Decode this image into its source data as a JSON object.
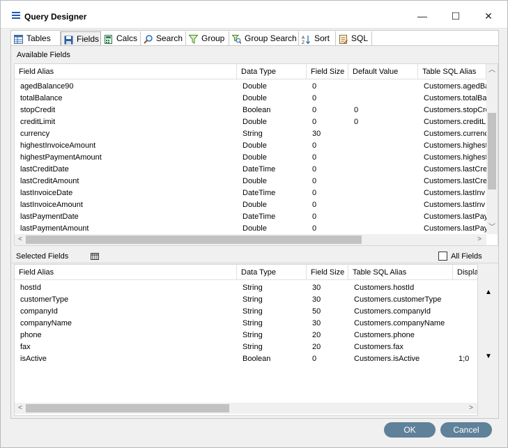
{
  "window": {
    "title": "Query Designer",
    "minimize": "—",
    "maximize": "☐",
    "close": "✕"
  },
  "tabs": [
    {
      "label": "Tables",
      "icon": "table-icon"
    },
    {
      "label": "Fields",
      "icon": "save-disk-icon"
    },
    {
      "label": "Calcs",
      "icon": "calculator-icon"
    },
    {
      "label": "Search",
      "icon": "magnifier-icon"
    },
    {
      "label": "Group",
      "icon": "funnel-icon"
    },
    {
      "label": "Group Search",
      "icon": "funnel-search-icon"
    },
    {
      "label": "Sort",
      "icon": "sort-az-icon"
    },
    {
      "label": "SQL",
      "icon": "sql-script-icon"
    }
  ],
  "available": {
    "label": "Available Fields",
    "columns": [
      "Field Alias",
      "Data Type",
      "Field Size",
      "Default Value",
      "Table SQL Alias"
    ],
    "rows": [
      [
        "agedBalance90",
        "Double",
        "0",
        "",
        "Customers.agedBa"
      ],
      [
        "totalBalance",
        "Double",
        "0",
        "",
        "Customers.totalBa"
      ],
      [
        "stopCredit",
        "Boolean",
        "0",
        "0",
        "Customers.stopCre"
      ],
      [
        "creditLimit",
        "Double",
        "0",
        "0",
        "Customers.creditLi"
      ],
      [
        "currency",
        "String",
        "30",
        "",
        "Customers.currenc"
      ],
      [
        "highestInvoiceAmount",
        "Double",
        "0",
        "",
        "Customers.highest"
      ],
      [
        "highestPaymentAmount",
        "Double",
        "0",
        "",
        "Customers.highest"
      ],
      [
        "lastCreditDate",
        "DateTime",
        "0",
        "",
        "Customers.lastCre"
      ],
      [
        "lastCreditAmount",
        "Double",
        "0",
        "",
        "Customers.lastCre"
      ],
      [
        "lastInvoiceDate",
        "DateTime",
        "0",
        "",
        "Customers.lastInv"
      ],
      [
        "lastInvoiceAmount",
        "Double",
        "0",
        "",
        "Customers.lastInv"
      ],
      [
        "lastPaymentDate",
        "DateTime",
        "0",
        "",
        "Customers.lastPay"
      ],
      [
        "lastPaymentAmount",
        "Double",
        "0",
        "",
        "Customers.lastPay"
      ]
    ]
  },
  "selected": {
    "label": "Selected Fields",
    "all_fields_label": "All Fields",
    "columns": [
      "Field Alias",
      "Data Type",
      "Field Size",
      "Table SQL Alias",
      "Displa"
    ],
    "rows": [
      [
        "hostId",
        "String",
        "30",
        "Customers.hostId",
        ""
      ],
      [
        "customerType",
        "String",
        "30",
        "Customers.customerType",
        ""
      ],
      [
        "companyId",
        "String",
        "50",
        "Customers.companyId",
        ""
      ],
      [
        "companyName",
        "String",
        "30",
        "Customers.companyName",
        ""
      ],
      [
        "phone",
        "String",
        "20",
        "Customers.phone",
        ""
      ],
      [
        "fax",
        "String",
        "20",
        "Customers.fax",
        ""
      ],
      [
        "isActive",
        "Boolean",
        "0",
        "Customers.isActive",
        "1;0"
      ]
    ]
  },
  "buttons": {
    "ok": "OK",
    "cancel": "Cancel"
  }
}
